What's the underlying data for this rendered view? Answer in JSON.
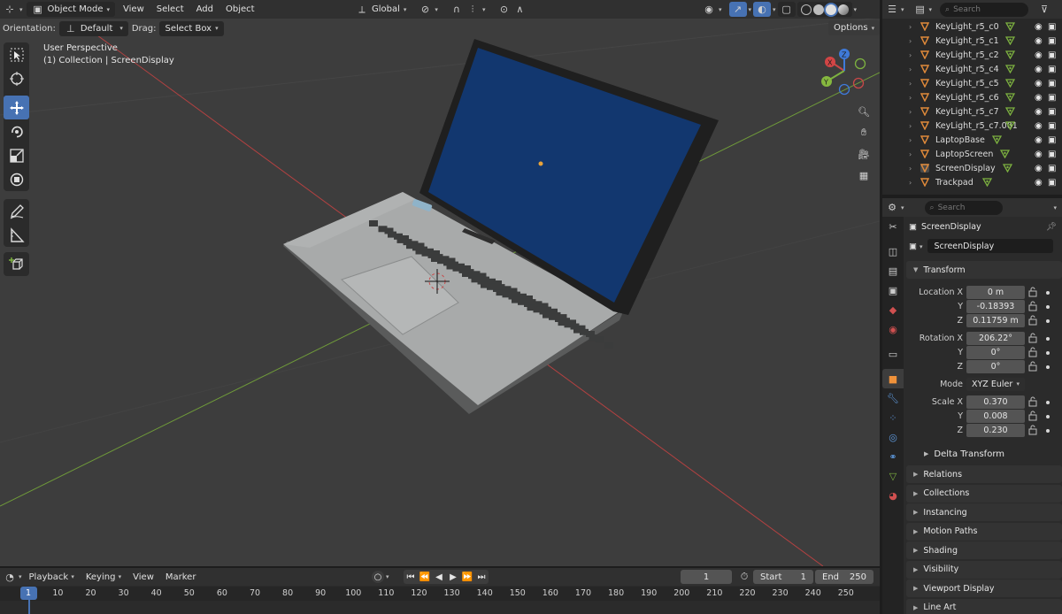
{
  "viewport": {
    "header": {
      "mode": "Object Mode",
      "menus": [
        "View",
        "Select",
        "Add",
        "Object"
      ],
      "transform_orientation": "Global"
    },
    "tool_settings": {
      "orientation_label": "Orientation:",
      "orientation_value": "Default",
      "drag_label": "Drag:",
      "drag_value": "Select Box",
      "options_label": "Options"
    },
    "overlay_info": {
      "view_name": "User Perspective",
      "collection_info": "(1) Collection | ScreenDisplay"
    },
    "gizmo_axes": [
      "X",
      "Y",
      "Z"
    ],
    "toolbar_tools": [
      "select-box",
      "cursor",
      "move",
      "rotate",
      "scale",
      "transform",
      "annotate",
      "measure",
      "add-cube"
    ],
    "active_tool": "move",
    "colors": {
      "viewport_bg": "#3d3d3d",
      "screen_blue": "#12376f",
      "laptop_silver": "#a9abab",
      "x_axis": "#b34141",
      "y_axis": "#6f9a3a",
      "accent": "#4772b3"
    }
  },
  "outliner": {
    "search_placeholder": "Search",
    "items": [
      {
        "name": "KeyLight_r5_c0",
        "type": "light"
      },
      {
        "name": "KeyLight_r5_c1",
        "type": "light"
      },
      {
        "name": "KeyLight_r5_c2",
        "type": "light"
      },
      {
        "name": "KeyLight_r5_c4",
        "type": "light"
      },
      {
        "name": "KeyLight_r5_c5",
        "type": "light"
      },
      {
        "name": "KeyLight_r5_c6",
        "type": "light"
      },
      {
        "name": "KeyLight_r5_c7",
        "type": "light"
      },
      {
        "name": "KeyLight_r5_c7.001",
        "type": "light"
      },
      {
        "name": "LaptopBase",
        "type": "mesh"
      },
      {
        "name": "LaptopScreen",
        "type": "mesh"
      },
      {
        "name": "ScreenDisplay",
        "type": "mesh",
        "selected": true
      },
      {
        "name": "Trackpad",
        "type": "mesh"
      }
    ]
  },
  "properties": {
    "search_placeholder": "Search",
    "object_name": "ScreenDisplay",
    "data_name": "ScreenDisplay",
    "transform_label": "Transform",
    "location": {
      "label": "Location X",
      "x": "0 m",
      "y": "-0.18393",
      "z": "0.11759 m"
    },
    "rotation": {
      "label": "Rotation X",
      "x": "206.22°",
      "y": "0°",
      "z": "0°"
    },
    "mode": {
      "label": "Mode",
      "value": "XYZ Euler"
    },
    "scale": {
      "label": "Scale X",
      "x": "0.370",
      "y": "0.008",
      "z": "0.230"
    },
    "axis_labels": {
      "y": "Y",
      "z": "Z"
    },
    "delta_transform": "Delta Transform",
    "panels": [
      "Relations",
      "Collections",
      "Instancing",
      "Motion Paths",
      "Shading",
      "Visibility",
      "Viewport Display",
      "Line Art"
    ]
  },
  "timeline": {
    "menus": [
      "Playback",
      "Keying",
      "View",
      "Marker"
    ],
    "current_frame": "1",
    "start_label": "Start",
    "start_value": "1",
    "end_label": "End",
    "end_value": "250",
    "ruler_ticks": [
      "1",
      "10",
      "20",
      "30",
      "40",
      "50",
      "60",
      "70",
      "80",
      "90",
      "100",
      "110",
      "120",
      "130",
      "140",
      "150",
      "160",
      "170",
      "180",
      "190",
      "200",
      "210",
      "220",
      "230",
      "240",
      "250"
    ]
  }
}
